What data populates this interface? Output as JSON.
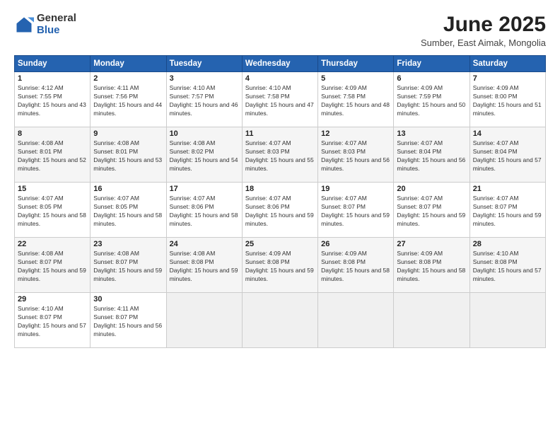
{
  "logo": {
    "general": "General",
    "blue": "Blue"
  },
  "title": "June 2025",
  "subtitle": "Sumber, East Aimak, Mongolia",
  "headers": [
    "Sunday",
    "Monday",
    "Tuesday",
    "Wednesday",
    "Thursday",
    "Friday",
    "Saturday"
  ],
  "weeks": [
    [
      {
        "day": "1",
        "sunrise": "Sunrise: 4:12 AM",
        "sunset": "Sunset: 7:55 PM",
        "daylight": "Daylight: 15 hours and 43 minutes."
      },
      {
        "day": "2",
        "sunrise": "Sunrise: 4:11 AM",
        "sunset": "Sunset: 7:56 PM",
        "daylight": "Daylight: 15 hours and 44 minutes."
      },
      {
        "day": "3",
        "sunrise": "Sunrise: 4:10 AM",
        "sunset": "Sunset: 7:57 PM",
        "daylight": "Daylight: 15 hours and 46 minutes."
      },
      {
        "day": "4",
        "sunrise": "Sunrise: 4:10 AM",
        "sunset": "Sunset: 7:58 PM",
        "daylight": "Daylight: 15 hours and 47 minutes."
      },
      {
        "day": "5",
        "sunrise": "Sunrise: 4:09 AM",
        "sunset": "Sunset: 7:58 PM",
        "daylight": "Daylight: 15 hours and 48 minutes."
      },
      {
        "day": "6",
        "sunrise": "Sunrise: 4:09 AM",
        "sunset": "Sunset: 7:59 PM",
        "daylight": "Daylight: 15 hours and 50 minutes."
      },
      {
        "day": "7",
        "sunrise": "Sunrise: 4:09 AM",
        "sunset": "Sunset: 8:00 PM",
        "daylight": "Daylight: 15 hours and 51 minutes."
      }
    ],
    [
      {
        "day": "8",
        "sunrise": "Sunrise: 4:08 AM",
        "sunset": "Sunset: 8:01 PM",
        "daylight": "Daylight: 15 hours and 52 minutes."
      },
      {
        "day": "9",
        "sunrise": "Sunrise: 4:08 AM",
        "sunset": "Sunset: 8:01 PM",
        "daylight": "Daylight: 15 hours and 53 minutes."
      },
      {
        "day": "10",
        "sunrise": "Sunrise: 4:08 AM",
        "sunset": "Sunset: 8:02 PM",
        "daylight": "Daylight: 15 hours and 54 minutes."
      },
      {
        "day": "11",
        "sunrise": "Sunrise: 4:07 AM",
        "sunset": "Sunset: 8:03 PM",
        "daylight": "Daylight: 15 hours and 55 minutes."
      },
      {
        "day": "12",
        "sunrise": "Sunrise: 4:07 AM",
        "sunset": "Sunset: 8:03 PM",
        "daylight": "Daylight: 15 hours and 56 minutes."
      },
      {
        "day": "13",
        "sunrise": "Sunrise: 4:07 AM",
        "sunset": "Sunset: 8:04 PM",
        "daylight": "Daylight: 15 hours and 56 minutes."
      },
      {
        "day": "14",
        "sunrise": "Sunrise: 4:07 AM",
        "sunset": "Sunset: 8:04 PM",
        "daylight": "Daylight: 15 hours and 57 minutes."
      }
    ],
    [
      {
        "day": "15",
        "sunrise": "Sunrise: 4:07 AM",
        "sunset": "Sunset: 8:05 PM",
        "daylight": "Daylight: 15 hours and 58 minutes."
      },
      {
        "day": "16",
        "sunrise": "Sunrise: 4:07 AM",
        "sunset": "Sunset: 8:05 PM",
        "daylight": "Daylight: 15 hours and 58 minutes."
      },
      {
        "day": "17",
        "sunrise": "Sunrise: 4:07 AM",
        "sunset": "Sunset: 8:06 PM",
        "daylight": "Daylight: 15 hours and 58 minutes."
      },
      {
        "day": "18",
        "sunrise": "Sunrise: 4:07 AM",
        "sunset": "Sunset: 8:06 PM",
        "daylight": "Daylight: 15 hours and 59 minutes."
      },
      {
        "day": "19",
        "sunrise": "Sunrise: 4:07 AM",
        "sunset": "Sunset: 8:07 PM",
        "daylight": "Daylight: 15 hours and 59 minutes."
      },
      {
        "day": "20",
        "sunrise": "Sunrise: 4:07 AM",
        "sunset": "Sunset: 8:07 PM",
        "daylight": "Daylight: 15 hours and 59 minutes."
      },
      {
        "day": "21",
        "sunrise": "Sunrise: 4:07 AM",
        "sunset": "Sunset: 8:07 PM",
        "daylight": "Daylight: 15 hours and 59 minutes."
      }
    ],
    [
      {
        "day": "22",
        "sunrise": "Sunrise: 4:08 AM",
        "sunset": "Sunset: 8:07 PM",
        "daylight": "Daylight: 15 hours and 59 minutes."
      },
      {
        "day": "23",
        "sunrise": "Sunrise: 4:08 AM",
        "sunset": "Sunset: 8:07 PM",
        "daylight": "Daylight: 15 hours and 59 minutes."
      },
      {
        "day": "24",
        "sunrise": "Sunrise: 4:08 AM",
        "sunset": "Sunset: 8:08 PM",
        "daylight": "Daylight: 15 hours and 59 minutes."
      },
      {
        "day": "25",
        "sunrise": "Sunrise: 4:09 AM",
        "sunset": "Sunset: 8:08 PM",
        "daylight": "Daylight: 15 hours and 59 minutes."
      },
      {
        "day": "26",
        "sunrise": "Sunrise: 4:09 AM",
        "sunset": "Sunset: 8:08 PM",
        "daylight": "Daylight: 15 hours and 58 minutes."
      },
      {
        "day": "27",
        "sunrise": "Sunrise: 4:09 AM",
        "sunset": "Sunset: 8:08 PM",
        "daylight": "Daylight: 15 hours and 58 minutes."
      },
      {
        "day": "28",
        "sunrise": "Sunrise: 4:10 AM",
        "sunset": "Sunset: 8:08 PM",
        "daylight": "Daylight: 15 hours and 57 minutes."
      }
    ],
    [
      {
        "day": "29",
        "sunrise": "Sunrise: 4:10 AM",
        "sunset": "Sunset: 8:07 PM",
        "daylight": "Daylight: 15 hours and 57 minutes."
      },
      {
        "day": "30",
        "sunrise": "Sunrise: 4:11 AM",
        "sunset": "Sunset: 8:07 PM",
        "daylight": "Daylight: 15 hours and 56 minutes."
      },
      null,
      null,
      null,
      null,
      null
    ]
  ]
}
